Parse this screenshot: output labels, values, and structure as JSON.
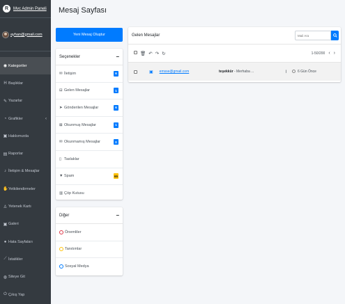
{
  "brand": {
    "logo_letter": "R",
    "title": "Mvc Admin Paneli"
  },
  "user": {
    "email": "ayhan@gmail.com"
  },
  "sidebar": {
    "items": [
      {
        "label": "Kategoriler",
        "icon": "gauge-icon",
        "glyph": "◉",
        "active": true
      },
      {
        "label": "Başlıklar",
        "icon": "heading-icon",
        "glyph": "H"
      },
      {
        "label": "Yazarlar",
        "icon": "pen-icon",
        "glyph": "✎"
      },
      {
        "label": "Grafikler",
        "icon": "chart-pie-icon",
        "glyph": "◔",
        "chevron": "‹"
      },
      {
        "label": "Hakkımızda",
        "icon": "info-box-icon",
        "glyph": "▣"
      },
      {
        "label": "Raporlar",
        "icon": "report-icon",
        "glyph": "▤"
      },
      {
        "label": "İletişim & Mesajlar",
        "icon": "music-icon",
        "glyph": "♪"
      },
      {
        "label": "Yetkilendirmeler",
        "icon": "thumbs-icon",
        "glyph": "✋"
      },
      {
        "label": "Yetenek Kartı",
        "icon": "user-card-icon",
        "glyph": "♙"
      },
      {
        "label": "Galeri",
        "icon": "image-icon",
        "glyph": "▣"
      },
      {
        "label": "Hata Sayfaları",
        "icon": "error-icon",
        "glyph": "●"
      },
      {
        "label": "İstatikler",
        "icon": "line-chart-icon",
        "glyph": "⟋"
      },
      {
        "label": "Siteye Git",
        "icon": "globe-icon",
        "glyph": "◍"
      },
      {
        "label": "Çıkış Yap",
        "icon": "power-icon",
        "glyph": "⏻"
      }
    ]
  },
  "page": {
    "title": "Mesaj Sayfası"
  },
  "new_message_button": "Yeni Mesaj Oluştur",
  "options": {
    "title": "Seçenekler",
    "collapse": "−",
    "items": [
      {
        "label": "İletişim",
        "icon": "inbox-icon",
        "glyph": "✉",
        "badge": "6"
      },
      {
        "label": "Gelen Mesajlar",
        "icon": "inbox-tray-icon",
        "glyph": "⊟",
        "badge": "1"
      },
      {
        "label": "Gönderilen Mesajlar",
        "icon": "send-icon",
        "glyph": "➤",
        "badge": "6"
      },
      {
        "label": "Okunmuş Mesajlar",
        "icon": "envelope-open-icon",
        "glyph": "⊠",
        "badge": "1"
      },
      {
        "label": "Okunmamış Mesajlar",
        "icon": "envelope-icon",
        "glyph": "✉",
        "badge": "0"
      },
      {
        "label": "Taslaklar",
        "icon": "file-icon",
        "glyph": "▯"
      },
      {
        "label": "Spam",
        "icon": "filter-icon",
        "glyph": "▼",
        "badge": "65",
        "badge_color": "yellow"
      },
      {
        "label": "Çöp Kutusu",
        "icon": "trash-icon",
        "glyph": "▥"
      }
    ]
  },
  "other": {
    "title": "Diğer",
    "collapse": "−",
    "items": [
      {
        "label": "Önemliler",
        "icon": "circle-red-icon",
        "color": "#dc3545"
      },
      {
        "label": "Tanıtımlar",
        "icon": "circle-yellow-icon",
        "color": "#ffc107"
      },
      {
        "label": "Sosyal Medya",
        "icon": "circle-blue-icon",
        "color": "#007bff"
      }
    ]
  },
  "inbox": {
    "title": "Gelen Mesajlar",
    "search_placeholder": "Mail Ara",
    "pager_text": "1-50/200",
    "prev": "‹",
    "next": "›",
    "messages": [
      {
        "sender": "emsse@gmail.com",
        "subject_bold": "teşekkür",
        "subject_rest": " - Merhaba ...",
        "time": "6 Gün Önce"
      }
    ]
  },
  "colors": {
    "primary": "#007bff",
    "sidebar": "#343a40",
    "warning": "#ffc107"
  }
}
